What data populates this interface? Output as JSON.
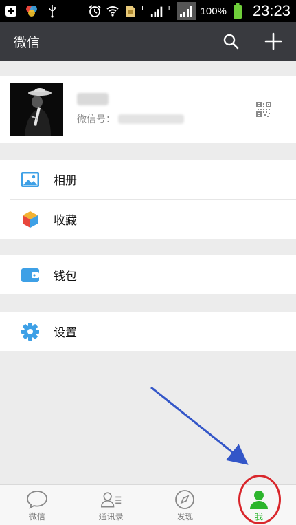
{
  "status_bar": {
    "battery": "100%",
    "time": "23:23",
    "network_type_1": "E",
    "network_type_2": "E",
    "icons": [
      "add-icon",
      "color-wheel-icon",
      "usb-icon",
      "alarm-icon",
      "wifi-icon",
      "sim-card-icon",
      "signal-icon",
      "signal-icon",
      "battery-icon"
    ]
  },
  "title_bar": {
    "title": "微信",
    "icons": [
      "search-icon",
      "plus-icon"
    ]
  },
  "profile": {
    "wechat_id_label": "微信号：",
    "icons": [
      "qr-code-icon"
    ]
  },
  "menu": {
    "group1": [
      {
        "label": "相册",
        "icon": "photo-album-icon",
        "color": "#3ea0e6"
      },
      {
        "label": "收藏",
        "icon": "favorites-cube-icon",
        "color": "#f2b233"
      }
    ],
    "group2": [
      {
        "label": "钱包",
        "icon": "wallet-icon",
        "color": "#3ea0e6"
      }
    ],
    "group3": [
      {
        "label": "设置",
        "icon": "settings-gear-icon",
        "color": "#3ea0e6"
      }
    ]
  },
  "tab_bar": {
    "tabs": [
      {
        "label": "微信",
        "icon": "chat-bubble-icon",
        "active": false
      },
      {
        "label": "通讯录",
        "icon": "contacts-icon",
        "active": false
      },
      {
        "label": "发现",
        "icon": "compass-icon",
        "active": false
      },
      {
        "label": "我",
        "icon": "me-person-icon",
        "active": true
      }
    ],
    "active_color": "#2db52d",
    "highlight_color": "#d9262b"
  },
  "annotation": {
    "arrow_color": "#3356c8"
  }
}
